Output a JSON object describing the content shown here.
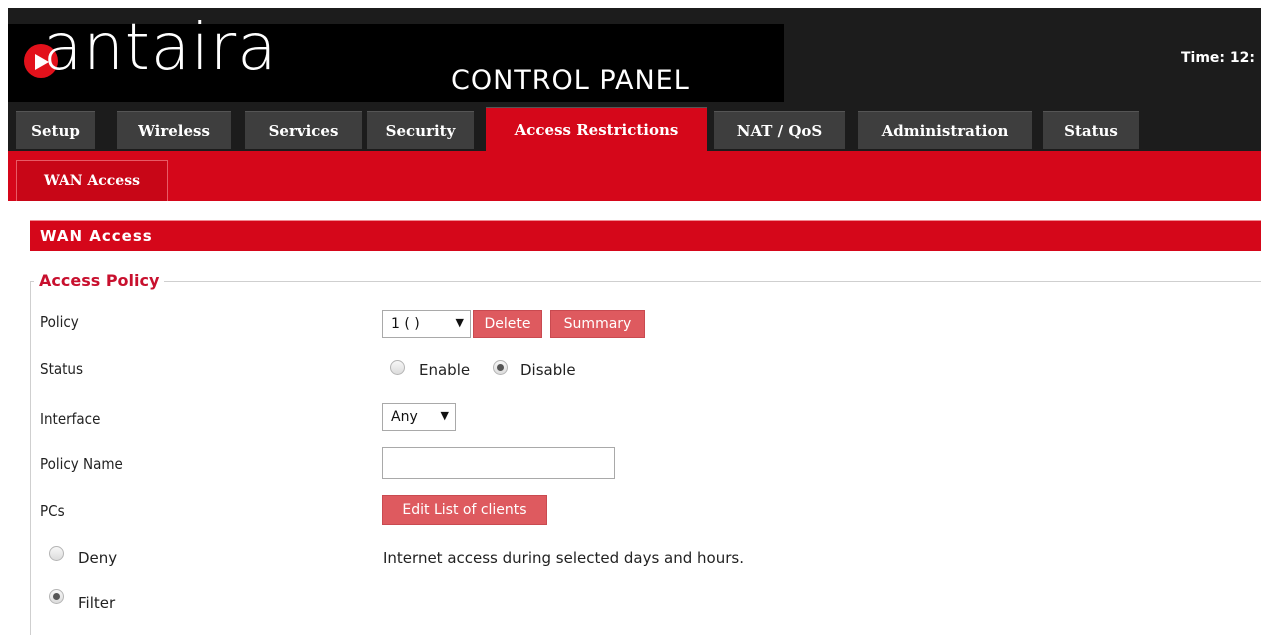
{
  "header": {
    "logo_text": "antaira",
    "panel_title": "CONTROL PANEL",
    "time_label": "Time: 12:"
  },
  "tabs": [
    {
      "label": "Setup",
      "active": false
    },
    {
      "label": "Wireless",
      "active": false
    },
    {
      "label": "Services",
      "active": false
    },
    {
      "label": "Security",
      "active": false
    },
    {
      "label": "Access Restrictions",
      "active": true
    },
    {
      "label": "NAT / QoS",
      "active": false
    },
    {
      "label": "Administration",
      "active": false
    },
    {
      "label": "Status",
      "active": false
    }
  ],
  "subnav": {
    "active_tab": "WAN Access"
  },
  "section": {
    "title": "WAN Access",
    "fieldset_legend": "Access Policy"
  },
  "form": {
    "policy_label": "Policy",
    "policy_value": "1 ( )",
    "delete_button": "Delete",
    "summary_button": "Summary",
    "status_label": "Status",
    "status_enable": "Enable",
    "status_disable": "Disable",
    "status_selected": "Disable",
    "interface_label": "Interface",
    "interface_value": "Any",
    "policy_name_label": "Policy Name",
    "policy_name_value": "",
    "pcs_label": "PCs",
    "edit_clients_button": "Edit List of clients",
    "deny_label": "Deny",
    "filter_label": "Filter",
    "access_selected": "Filter",
    "description": "Internet access during selected days and hours."
  },
  "colors": {
    "accent_red": "#d5071a",
    "button_red": "#de5a5f",
    "legend_red": "#c8102e",
    "header_dark": "#1c1c1c"
  }
}
